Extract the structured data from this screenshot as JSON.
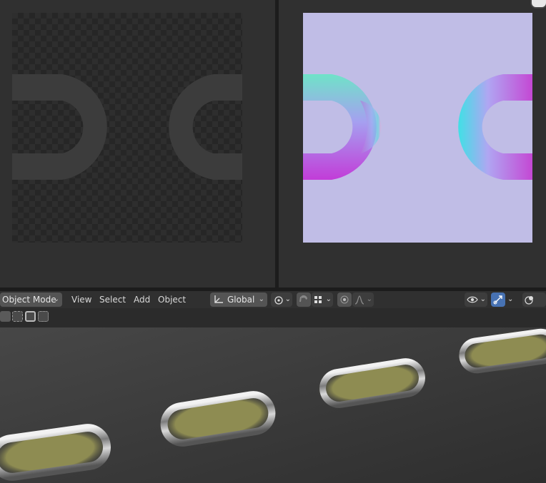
{
  "header": {
    "mode_label": "Object Mode",
    "menus": [
      "View",
      "Select",
      "Add",
      "Object"
    ],
    "transform_orientation": "Global"
  },
  "icons": {
    "mode_dropdown": "chevron-down-icon",
    "orientation": "transform-axes-icon",
    "pivot": "pivot-point-icon",
    "snap": "magnet-icon",
    "snap_target": "grid-icon",
    "proportional": "proportional-edit-icon",
    "falloff": "falloff-curve-icon",
    "visibility": "eye-icon",
    "gizmo": "gizmo-icon",
    "overlays": "overlays-icon"
  },
  "colors": {
    "normal_map_base": "#c0bde6",
    "active_button": "#4772b3",
    "panel": "#303030"
  }
}
